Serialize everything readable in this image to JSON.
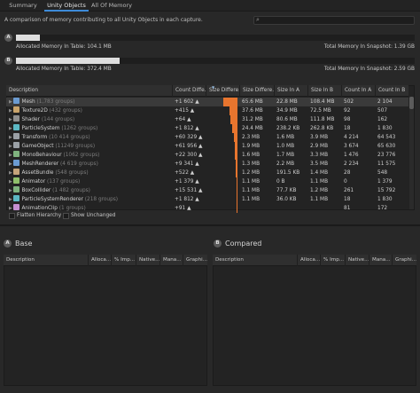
{
  "tabs": [
    {
      "label": "Summary"
    },
    {
      "label": "Unity Objects"
    },
    {
      "label": "All Of Memory"
    }
  ],
  "description": "A comparison of memory contributing to all Unity Objects in each capture.",
  "search": {
    "placeholder": ""
  },
  "snapshots": {
    "a": {
      "badge": "A",
      "allocated": "Allocated Memory In Table: 104.1 MB",
      "total": "Total Memory In Snapshot: 1.39 GB",
      "fill": 0.06
    },
    "b": {
      "badge": "B",
      "allocated": "Allocated Memory In Table: 372.4 MB",
      "total": "Total Memory In Snapshot: 2.59 GB",
      "fill": 0.26
    }
  },
  "table": {
    "columns": [
      "Description",
      "Count Diffe...",
      "Size Differe...",
      "Size Differe...",
      "Size In A",
      "Size In B",
      "Count In A",
      "Count In B"
    ],
    "rows": [
      {
        "name": "Mesh",
        "groups": "(1,783 groups)",
        "count_diff": "+1 602 ▲",
        "size_diff": "65.6 MB",
        "size_a": "22.8 MB",
        "size_b": "108.4 MB",
        "count_a": "502",
        "count_b": "2 104",
        "bar": 1.0,
        "icon": "#6b9bd1"
      },
      {
        "name": "Texture2D",
        "groups": "(432 groups)",
        "count_diff": "+415 ▲",
        "size_diff": "37.6 MB",
        "size_a": "34.9 MB",
        "size_b": "72.5 MB",
        "count_a": "92",
        "count_b": "507",
        "bar": 0.58,
        "icon": "#c9a46b"
      },
      {
        "name": "Shader",
        "groups": "(144 groups)",
        "count_diff": "+64 ▲",
        "size_diff": "31.2 MB",
        "size_a": "80.6 MB",
        "size_b": "111.8 MB",
        "count_a": "98",
        "count_b": "162",
        "bar": 0.5,
        "icon": "#8f8f8f"
      },
      {
        "name": "ParticleSystem",
        "groups": "(1262 groups)",
        "count_diff": "+1 812 ▲",
        "size_diff": "24.4 MB",
        "size_a": "238.2 KB",
        "size_b": "262.8 KB",
        "count_a": "18",
        "count_b": "1 830",
        "bar": 0.38,
        "icon": "#5cb8c4"
      },
      {
        "name": "Transform",
        "groups": "(10 414 groups)",
        "count_diff": "+60 329 ▲",
        "size_diff": "2.3 MB",
        "size_a": "1.6 MB",
        "size_b": "3.9 MB",
        "count_a": "4 214",
        "count_b": "64 543",
        "bar": 0.22,
        "icon": "#9aa0a6"
      },
      {
        "name": "GameObject",
        "groups": "(11249 groups)",
        "count_diff": "+61 956 ▲",
        "size_diff": "1.9 MB",
        "size_a": "1.0 MB",
        "size_b": "2.9 MB",
        "count_a": "3 674",
        "count_b": "65 630",
        "bar": 0.19,
        "icon": "#9aa0a6"
      },
      {
        "name": "MonoBehaviour",
        "groups": "(1062 groups)",
        "count_diff": "+22 300 ▲",
        "size_diff": "1.6 MB",
        "size_a": "1.7 MB",
        "size_b": "3.3 MB",
        "count_a": "1 476",
        "count_b": "23 776",
        "bar": 0.16,
        "icon": "#7fb37f"
      },
      {
        "name": "MeshRenderer",
        "groups": "(4 619 groups)",
        "count_diff": "+9 341 ▲",
        "size_diff": "1.3 MB",
        "size_a": "2.2 MB",
        "size_b": "3.5 MB",
        "count_a": "2 234",
        "count_b": "11 575",
        "bar": 0.13,
        "icon": "#6b9bd1"
      },
      {
        "name": "AssetBundle",
        "groups": "(548 groups)",
        "count_diff": "+522 ▲",
        "size_diff": "1.2 MB",
        "size_a": "191.5 KB",
        "size_b": "1.4 MB",
        "count_a": "28",
        "count_b": "548",
        "bar": 0.11,
        "icon": "#c4a37a"
      },
      {
        "name": "Animator",
        "groups": "(137 groups)",
        "count_diff": "+1 379 ▲",
        "size_diff": "1.1 MB",
        "size_a": "0 B",
        "size_b": "1.1 MB",
        "count_a": "0",
        "count_b": "1 379",
        "bar": 0.09,
        "icon": "#8fbf6b"
      },
      {
        "name": "BoxCollider",
        "groups": "(1 482 groups)",
        "count_diff": "+15 531 ▲",
        "size_diff": "1.1 MB",
        "size_a": "77.7 KB",
        "size_b": "1.2 MB",
        "count_a": "261",
        "count_b": "15 792",
        "bar": 0.08,
        "icon": "#7fb37f"
      },
      {
        "name": "ParticleSystemRenderer",
        "groups": "(218 groups)",
        "count_diff": "+1 812 ▲",
        "size_diff": "1.1 MB",
        "size_a": "36.0 KB",
        "size_b": "1.1 MB",
        "count_a": "18",
        "count_b": "1 830",
        "bar": 0.07,
        "icon": "#5cb8c4"
      },
      {
        "name": "AnimationClip",
        "groups": "(1 groups)",
        "count_diff": "+91 ▲",
        "size_diff": "",
        "size_a": "",
        "size_b": "",
        "count_a": "81",
        "count_b": "172",
        "bar": 0.06,
        "icon": "#c48fd1"
      }
    ]
  },
  "options": {
    "flatten": "Flatten Hierarchy",
    "unchanged": "Show Unchanged"
  },
  "base": {
    "badge": "A",
    "title": "Base",
    "columns": [
      "Description",
      "Alloca...",
      "% Imp...",
      "Native...",
      "Mana...",
      "Graphi..."
    ]
  },
  "compared": {
    "badge": "B",
    "title": "Compared",
    "columns": [
      "Description",
      "Alloca...",
      "% Imp...",
      "Native...",
      "Mana...",
      "Graphi..."
    ]
  }
}
